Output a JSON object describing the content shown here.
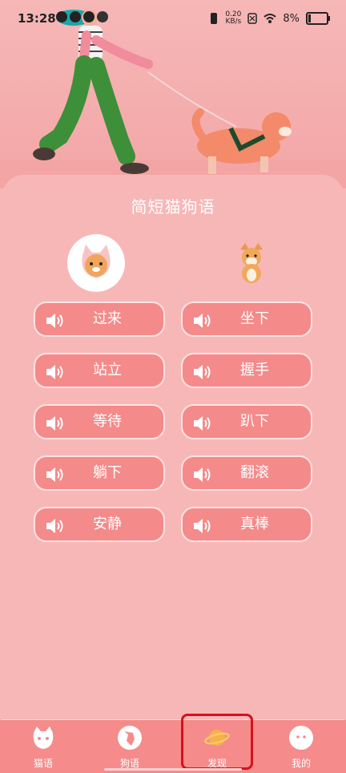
{
  "status_bar": {
    "time": "13:28",
    "net_speed_value": "0.20",
    "net_speed_unit": "KB/s",
    "battery": "8%"
  },
  "card": {
    "title": "简短猫狗语"
  },
  "phrases": [
    {
      "label": "过来"
    },
    {
      "label": "坐下"
    },
    {
      "label": "站立"
    },
    {
      "label": "握手"
    },
    {
      "label": "等待"
    },
    {
      "label": "趴下"
    },
    {
      "label": "躺下"
    },
    {
      "label": "翻滚"
    },
    {
      "label": "安静"
    },
    {
      "label": "真棒"
    }
  ],
  "nav": {
    "items": [
      {
        "label": "猫语",
        "icon": "cat-icon"
      },
      {
        "label": "狗语",
        "icon": "dog-icon"
      },
      {
        "label": "发现",
        "icon": "planet-icon"
      },
      {
        "label": "我的",
        "icon": "profile-icon"
      }
    ],
    "selected": "发现"
  },
  "colors": {
    "background": "#f6b7b7",
    "button": "#f48a8a",
    "nav": "#f58b8b",
    "planet": "#f6b24a",
    "highlight": "#d4111d"
  }
}
